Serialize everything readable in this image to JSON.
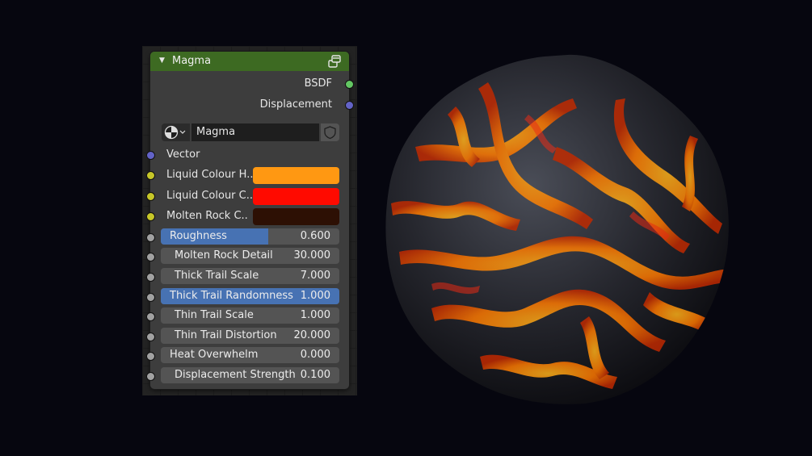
{
  "node": {
    "title": "Magma",
    "header_color": "#3d6a22",
    "outputs": [
      {
        "label": "BSDF",
        "socket_color": "#63c763"
      },
      {
        "label": "Displacement",
        "socket_color": "#6363c7"
      }
    ],
    "material": {
      "name": "Magma"
    },
    "vector": {
      "label": "Vector",
      "socket_color": "#6363c7"
    },
    "colors": [
      {
        "label": "Liquid Colour H..",
        "value": "#ff9812",
        "socket_color": "#c7c729"
      },
      {
        "label": "Liquid Colour C..",
        "value": "#ff0a00",
        "socket_color": "#c7c729"
      },
      {
        "label": "Molten Rock C..",
        "value": "#2d1004",
        "socket_color": "#c7c729"
      }
    ],
    "sliders": [
      {
        "label": "Roughness",
        "value": "0.600",
        "fraction": 0.6,
        "style": "fill",
        "label_align": "left"
      },
      {
        "label": "Molten Rock Detail",
        "value": "30.000",
        "style": "plain"
      },
      {
        "label": "Thick Trail Scale",
        "value": "7.000",
        "style": "plain"
      },
      {
        "label": "Thick Trail Randomness",
        "value": "1.000",
        "fraction": 1.0,
        "style": "fill",
        "label_align": "left"
      },
      {
        "label": "Thin Trail Scale",
        "value": "1.000",
        "style": "plain"
      },
      {
        "label": "Thin Trail Distortion",
        "value": "20.000",
        "style": "plain"
      },
      {
        "label": "Heat Overwhelm",
        "value": "0.000",
        "style": "plain",
        "label_align": "left"
      },
      {
        "label": "Displacement Strength",
        "value": "0.100",
        "style": "plain"
      }
    ],
    "slider_socket_color": "#a1a1a1"
  },
  "preview": {
    "icon": "magma-sphere-render"
  }
}
